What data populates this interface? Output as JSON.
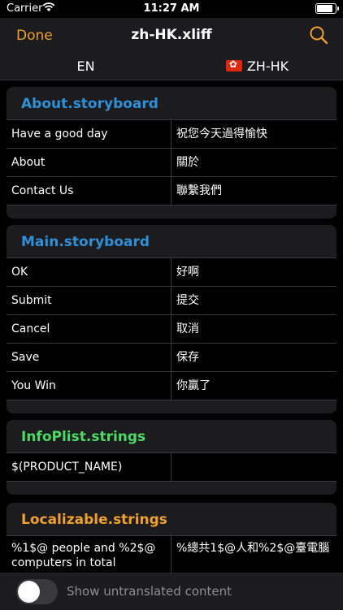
{
  "status": {
    "carrier": "Carrier",
    "time": "11:27 AM",
    "battery_level": 0.95
  },
  "nav": {
    "done_label": "Done",
    "title": "zh-HK.xliff",
    "search_icon": "search-icon"
  },
  "languages": {
    "source": "EN",
    "target": "ZH-HK",
    "target_flag": "hong-kong-flag-icon"
  },
  "sections": [
    {
      "title": "About.storyboard",
      "color": "#2f8fd8",
      "rows": [
        {
          "source": "Have a good day",
          "target": "祝您今天過得愉快"
        },
        {
          "source": "About",
          "target": "關於"
        },
        {
          "source": "Contact Us",
          "target": "聯繫我們"
        }
      ]
    },
    {
      "title": "Main.storyboard",
      "color": "#2f8fd8",
      "rows": [
        {
          "source": "OK",
          "target": "好啊"
        },
        {
          "source": "Submit",
          "target": "提交"
        },
        {
          "source": "Cancel",
          "target": "取消"
        },
        {
          "source": "Save",
          "target": "保存"
        },
        {
          "source": "You Win",
          "target": "你贏了"
        }
      ]
    },
    {
      "title": "InfoPlist.strings",
      "color": "#4cd964",
      "rows": [
        {
          "source": "$(PRODUCT_NAME)",
          "target": ""
        }
      ]
    },
    {
      "title": "Localizable.strings",
      "color": "#f0a030",
      "rows": [
        {
          "source": "%1$@ people and %2$@ computers in total",
          "target": "%總共1$@人和%2$@臺電腦"
        }
      ]
    }
  ],
  "bottom": {
    "toggle_label": "Show untranslated content",
    "toggle_on": false
  }
}
